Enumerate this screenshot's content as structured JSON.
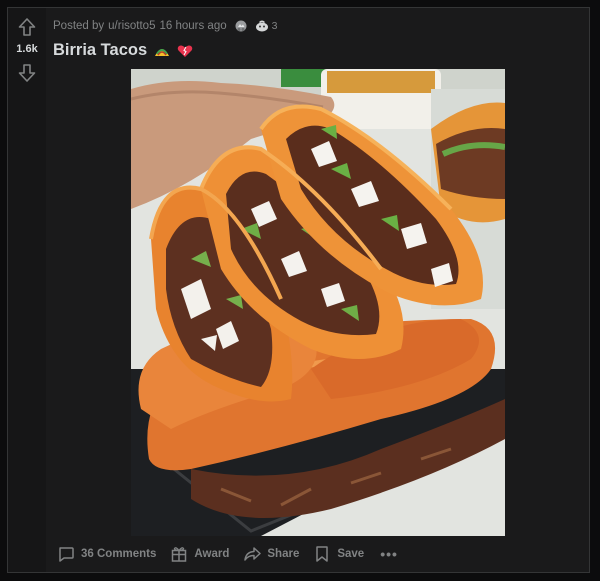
{
  "vote": {
    "score": "1.6k"
  },
  "post": {
    "meta_prefix": "Posted by",
    "author": "u/risotto5",
    "time": "16 hours ago",
    "award_count": "3",
    "title": "Birria Tacos",
    "image_alt": "Birria Tacos"
  },
  "actions": {
    "comments": "36 Comments",
    "award": "Award",
    "share": "Share",
    "save": "Save",
    "more": "•••"
  },
  "colors": {
    "background": "#0c0c0d",
    "card": "#1a1a1b",
    "text": "#d7dadc",
    "muted": "#818384"
  },
  "icons": {
    "upvote": "arrow-up-outline",
    "downvote": "arrow-down-outline",
    "award_silver": "silver-award",
    "award_helpful": "helpful-award",
    "flair_1": "taco-emoji",
    "flair_2": "heart-emoji",
    "comments": "speech-bubble",
    "award": "gift-box",
    "share": "share-arrow",
    "save": "bookmark",
    "more": "horizontal-dots"
  }
}
